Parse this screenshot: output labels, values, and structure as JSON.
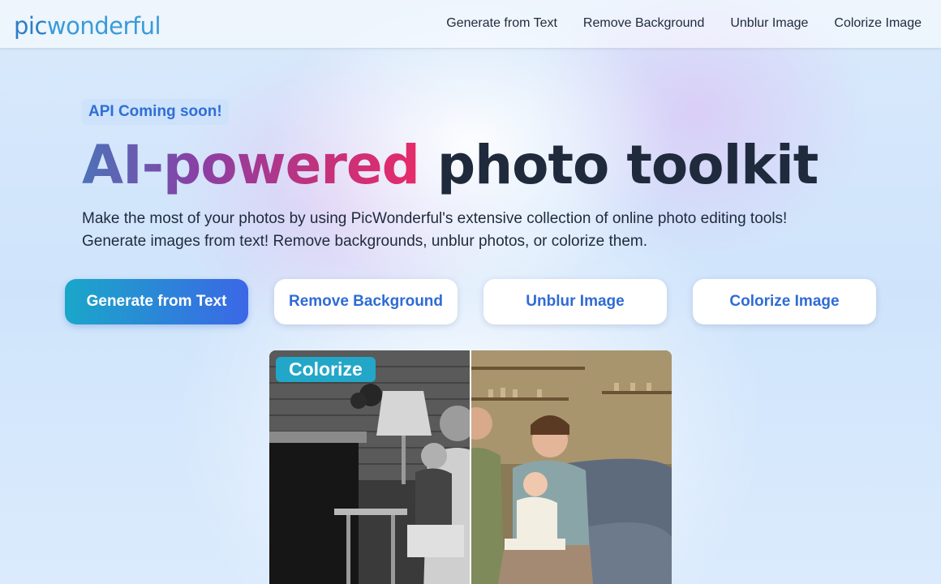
{
  "header": {
    "logo_part1": "pic",
    "logo_part2": "wonderful",
    "nav": [
      {
        "label": "Generate from Text"
      },
      {
        "label": "Remove Background"
      },
      {
        "label": "Unblur Image"
      },
      {
        "label": "Colorize Image"
      }
    ]
  },
  "hero": {
    "badge": "API Coming soon!",
    "title_gradient": "AI-powered",
    "title_rest": "photo toolkit",
    "subtitle_line1": "Make the most of your photos by using PicWonderful's extensive collection of online photo editing tools!",
    "subtitle_line2": "Generate images from text! Remove backgrounds, unblur photos, or colorize them."
  },
  "buttons": [
    {
      "label": "Generate from Text"
    },
    {
      "label": "Remove Background"
    },
    {
      "label": "Unblur Image"
    },
    {
      "label": "Colorize Image"
    }
  ],
  "preview": {
    "tag": "Colorize"
  },
  "colors": {
    "accent_blue": "#2f6bd6",
    "primary_gradient_start": "#1aa7c9",
    "primary_gradient_end": "#3b67e6",
    "title_gradient_start": "#4d72b8",
    "title_gradient_end": "#e62b6a"
  }
}
